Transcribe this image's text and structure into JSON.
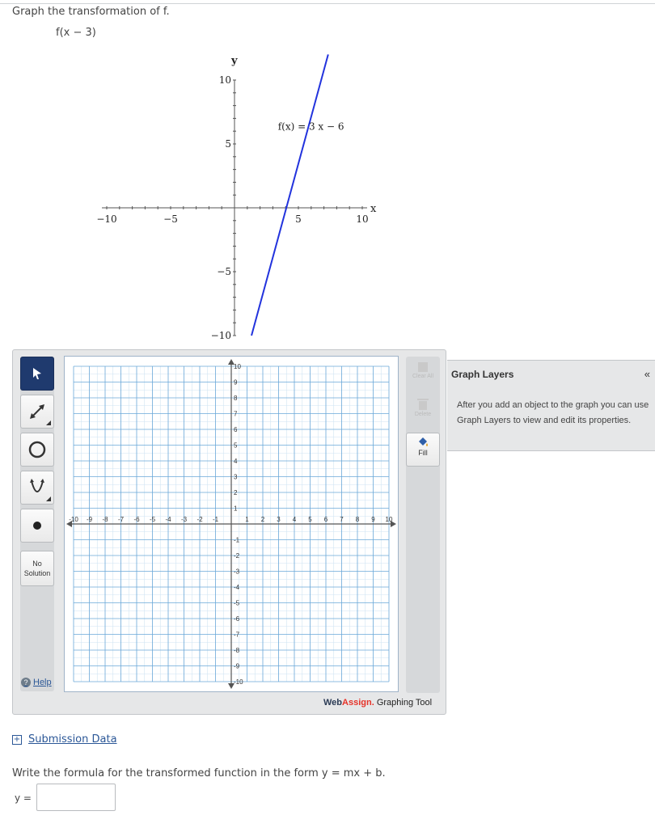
{
  "question": {
    "prompt": "Graph the transformation of f.",
    "expression": "f(x − 3)",
    "instruction": "Write the formula for the transformed function in the form  y = mx + b."
  },
  "reference_graph": {
    "chart_data": {
      "type": "line",
      "xlabel": "x",
      "ylabel": "y",
      "xlim": [
        -10,
        10
      ],
      "ylim": [
        -10,
        10
      ],
      "x_ticks": [
        "−10",
        "−5",
        "5",
        "10"
      ],
      "y_ticks": [
        "10",
        "5",
        "−5",
        "−10"
      ],
      "series": [
        {
          "name": "f(x) = 3 x − 6",
          "x": [
            1.33,
            7.33
          ],
          "y": [
            -10,
            12
          ]
        }
      ],
      "annotation": "f(x) = 3 x − 6",
      "line_color": "#2233dd"
    }
  },
  "graphing_tool": {
    "tools": [
      {
        "name": "pointer-tool",
        "icon": "arrow-pointer-icon",
        "active": true
      },
      {
        "name": "line-tool",
        "icon": "line-segment-icon",
        "active": false
      },
      {
        "name": "circle-tool",
        "icon": "circle-icon",
        "active": false
      },
      {
        "name": "parabola-tool",
        "icon": "parabola-icon",
        "active": false
      },
      {
        "name": "point-tool",
        "icon": "point-icon",
        "active": false
      }
    ],
    "no_solution_label": "No Solution",
    "help_label": "Help",
    "clear_all_label": "Clear All",
    "delete_label": "Delete",
    "fill_label": "Fill",
    "brand_name": "Web",
    "brand_accent": "Assign.",
    "brand_suffix": " Graphing Tool",
    "grid": {
      "xlim": [
        -10,
        10
      ],
      "ylim": [
        -10,
        10
      ],
      "x_tick_labels": [
        "-10",
        "-9",
        "-8",
        "-7",
        "-6",
        "-5",
        "-4",
        "-3",
        "-2",
        "-1",
        "1",
        "2",
        "3",
        "4",
        "5",
        "6",
        "7",
        "8",
        "9",
        "10"
      ],
      "y_tick_labels": [
        "10",
        "9",
        "8",
        "7",
        "6",
        "5",
        "4",
        "3",
        "2",
        "1",
        "-1",
        "-2",
        "-3",
        "-4",
        "-5",
        "-6",
        "-7",
        "-8",
        "-9",
        "-10"
      ],
      "colors": {
        "minor": "#cfe3f3",
        "major": "#6aa8d8",
        "axis": "#555555"
      }
    }
  },
  "graph_layers": {
    "title": "Graph Layers",
    "collapse_glyph": "«",
    "body": "After you add an object to the graph you can use Graph Layers to view and edit its properties."
  },
  "submission": {
    "label": "Submission Data"
  },
  "answer": {
    "label": "y =",
    "value": ""
  }
}
